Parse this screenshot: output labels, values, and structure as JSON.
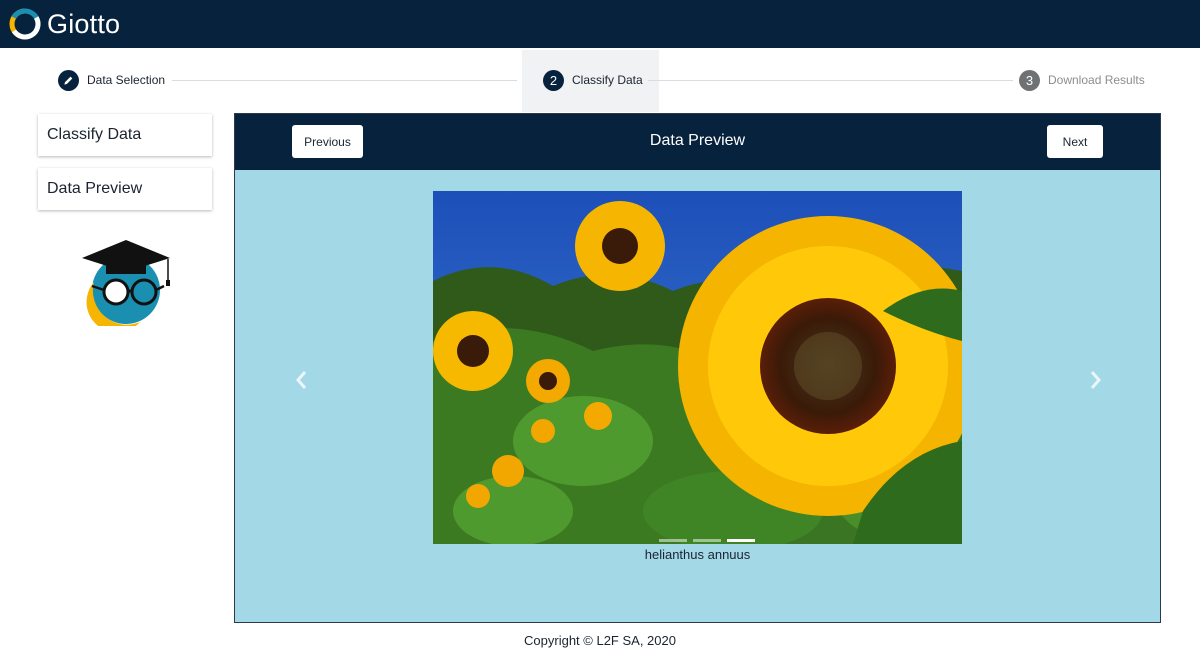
{
  "app": {
    "brand_name": "Giotto",
    "brand_icon": "giotto-ring-logo"
  },
  "stepper": {
    "steps": [
      {
        "number": "",
        "icon": "pencil-icon",
        "label": "Data Selection",
        "state": "completed"
      },
      {
        "number": "2",
        "label": "Classify Data",
        "state": "active"
      },
      {
        "number": "3",
        "label": "Download Results",
        "state": "inactive"
      }
    ]
  },
  "sidebar": {
    "items": [
      {
        "label": "Classify Data"
      },
      {
        "label": "Data Preview"
      }
    ],
    "mascot_icon": "graduate-mascot"
  },
  "panel": {
    "title": "Data Preview",
    "previous_label": "Previous",
    "next_label": "Next",
    "carousel": {
      "prev_icon": "chevron-left-icon",
      "next_icon": "chevron-right-icon",
      "caption": "helianthus annuus",
      "indicators": 3,
      "active_indicator": 3
    }
  },
  "footer": {
    "copyright": "Copyright © L2F SA, 2020"
  },
  "colors": {
    "navy": "#07223d",
    "panel_bg": "#a3d8e7",
    "accent_yellow": "#f6b500",
    "accent_teal": "#1a8fb0"
  }
}
